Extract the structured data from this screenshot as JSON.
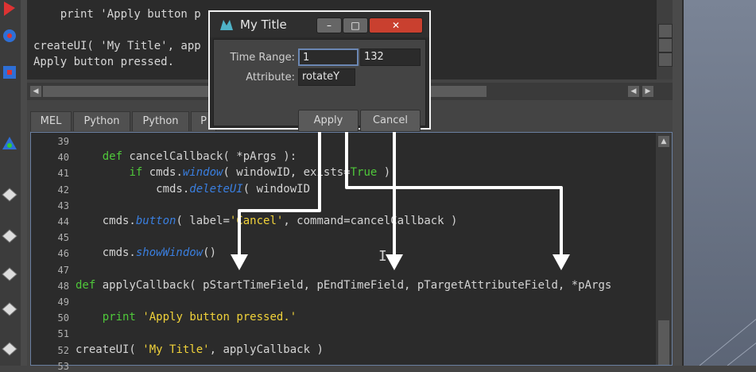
{
  "history": {
    "lines": [
      "    print 'Apply button p",
      "",
      "createUI( 'My Title', app",
      "Apply button pressed."
    ]
  },
  "tabs": [
    "MEL",
    "Python",
    "Python",
    "P"
  ],
  "dialog": {
    "title": "My Title",
    "time_range_label": "Time Range:",
    "start_value": "1",
    "end_value": "132",
    "attribute_label": "Attribute:",
    "attribute_value": "rotateY",
    "apply_label": "Apply",
    "cancel_label": "Cancel",
    "minimize_glyph": "–",
    "maximize_glyph": "□",
    "close_glyph": "✕"
  },
  "editor": {
    "line_numbers": [
      "39",
      "40",
      "41",
      "42",
      "43",
      "44",
      "45",
      "46",
      "47",
      "48",
      "49",
      "50",
      "51",
      "52",
      "53"
    ],
    "code_lines": [
      [],
      [
        {
          "t": "    "
        },
        {
          "t": "def",
          "c": "kw"
        },
        {
          "t": " cancelCallback( *pArgs ):"
        }
      ],
      [
        {
          "t": "        "
        },
        {
          "t": "if",
          "c": "kw"
        },
        {
          "t": " cmds."
        },
        {
          "t": "window",
          "c": "fn"
        },
        {
          "t": "( windowID, exists="
        },
        {
          "t": "True",
          "c": "kw"
        },
        {
          "t": " ):"
        }
      ],
      [
        {
          "t": "            cmds."
        },
        {
          "t": "deleteUI",
          "c": "fn"
        },
        {
          "t": "( windowID )"
        }
      ],
      [],
      [
        {
          "t": "    cmds."
        },
        {
          "t": "button",
          "c": "fn"
        },
        {
          "t": "( label="
        },
        {
          "t": "'Cancel'",
          "c": "str"
        },
        {
          "t": ", command=cancelCallback )"
        }
      ],
      [],
      [
        {
          "t": "    cmds."
        },
        {
          "t": "showWindow",
          "c": "fn"
        },
        {
          "t": "()"
        }
      ],
      [],
      [
        {
          "t": "def",
          "c": "kw"
        },
        {
          "t": " applyCallback( pStartTimeField, pEndTimeField, pTargetAttributeField, *pArgs"
        }
      ],
      [],
      [
        {
          "t": "    "
        },
        {
          "t": "print",
          "c": "kw"
        },
        {
          "t": " "
        },
        {
          "t": "'Apply button pressed.'",
          "c": "str"
        }
      ],
      [],
      [
        {
          "t": "createUI( "
        },
        {
          "t": "'My Title'",
          "c": "str"
        },
        {
          "t": ", applyCallback )"
        }
      ],
      []
    ]
  },
  "colors": {
    "keyword": "#4fc83a",
    "function": "#3a7fe0",
    "string": "#f0d23a",
    "arrow": "#ffffff"
  }
}
